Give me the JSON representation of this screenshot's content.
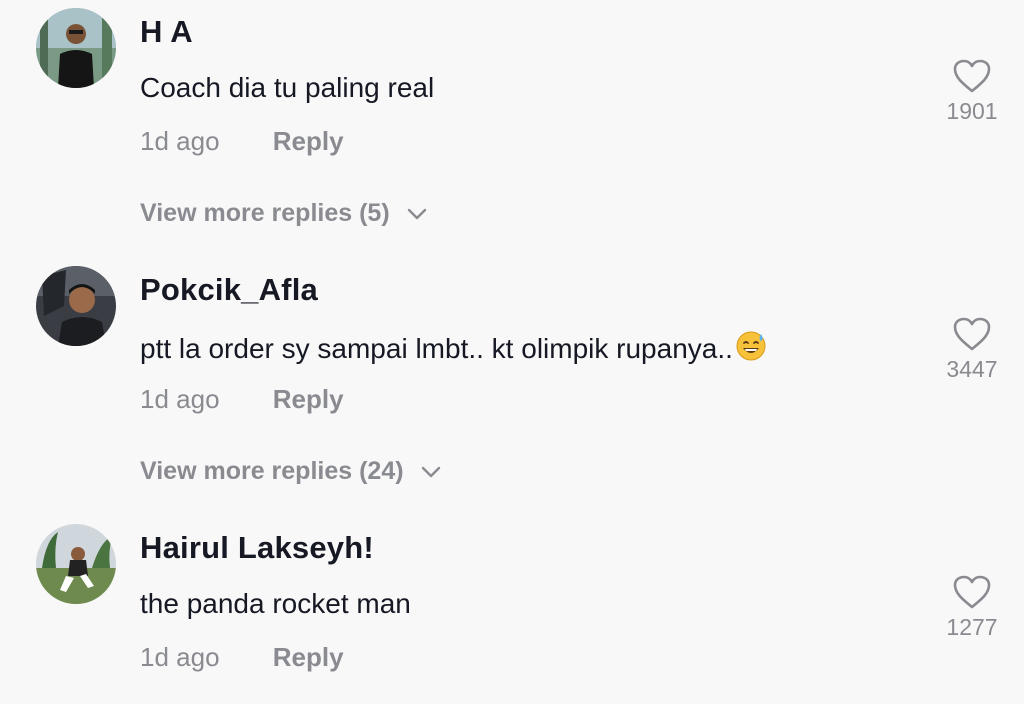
{
  "comments": [
    {
      "username": "H A",
      "text": "Coach dia tu paling real",
      "emoji": "",
      "time": "1d ago",
      "reply_label": "Reply",
      "likes": "1901",
      "view_more": "View more replies (5)",
      "avatar_icon": "avatar-icon"
    },
    {
      "username": "Pokcik_Afla",
      "text": "ptt la order sy sampai lmbt.. kt olimpik rupanya..",
      "emoji": "😅",
      "time": "1d ago",
      "reply_label": "Reply",
      "likes": "3447",
      "view_more": "View more replies (24)",
      "avatar_icon": "avatar-icon"
    },
    {
      "username": "Hairul Lakseyh!",
      "text": "the panda rocket man",
      "emoji": "",
      "time": "1d ago",
      "reply_label": "Reply",
      "likes": "1277",
      "view_more": "",
      "avatar_icon": "avatar-icon"
    }
  ],
  "colors": {
    "background": "#f8f8f8",
    "text": "#161823",
    "secondary": "#8a8b91"
  }
}
